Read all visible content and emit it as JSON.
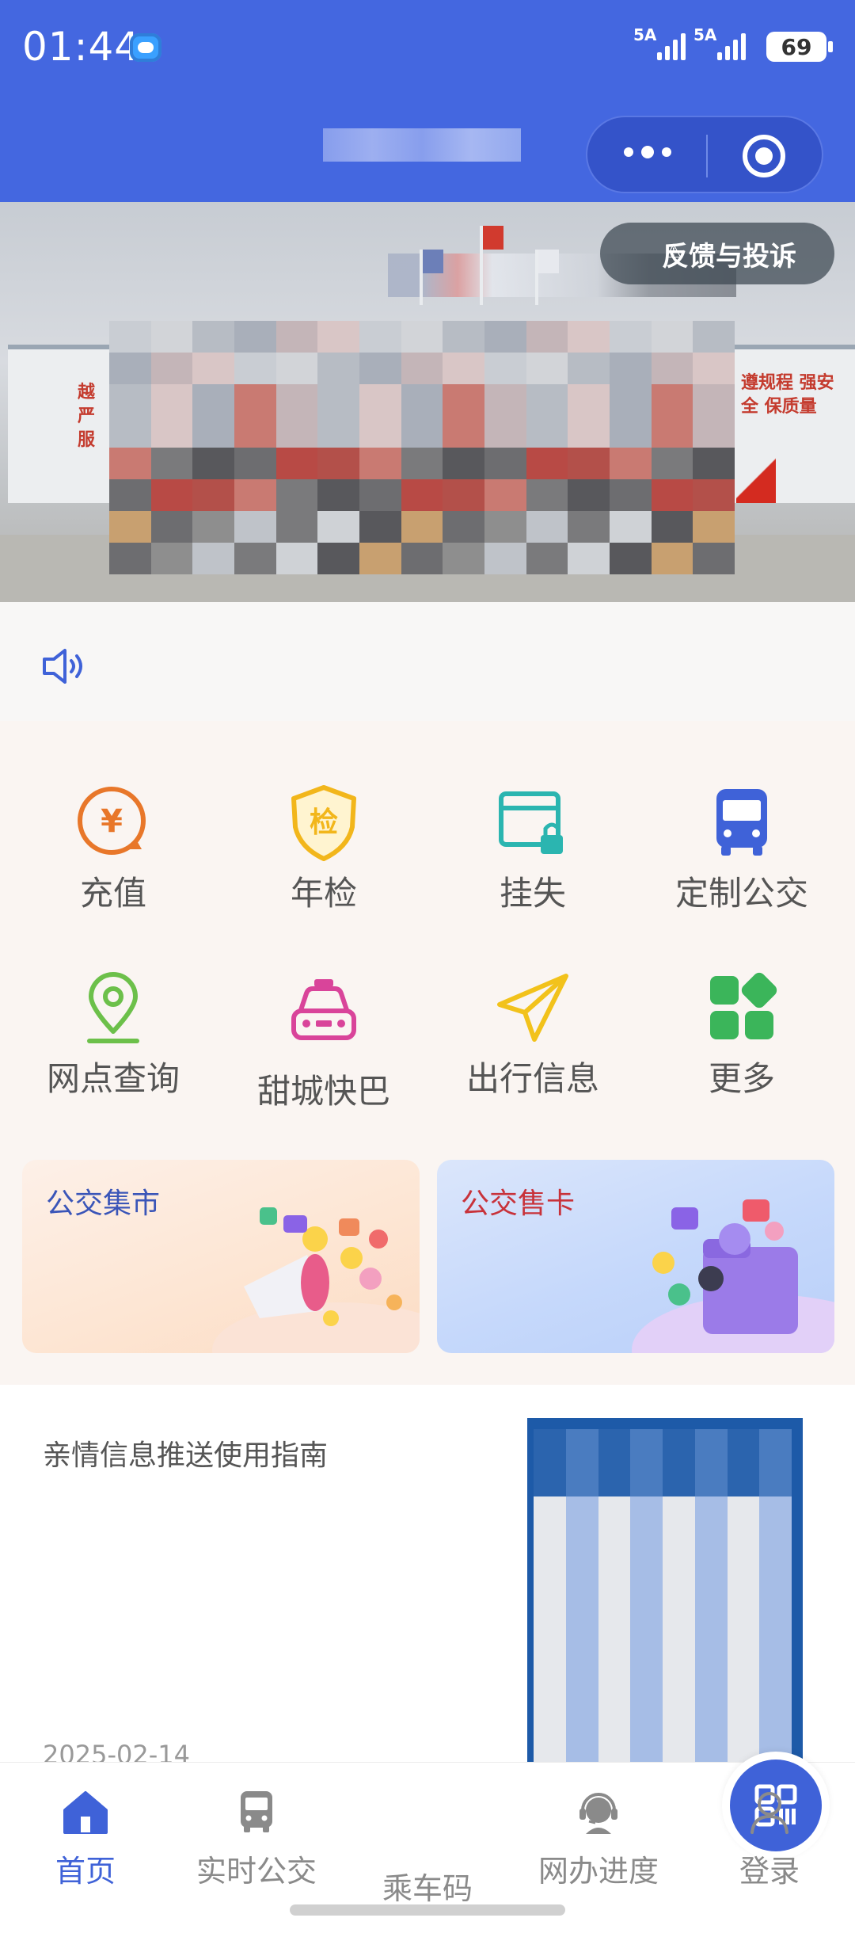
{
  "status_bar": {
    "time": "01:44",
    "signal1": "5A",
    "signal2": "5A",
    "battery": "69"
  },
  "header": {
    "menu_icon": "more-dots-icon",
    "target_icon": "target-icon"
  },
  "banner": {
    "feedback_label": "反馈与投诉",
    "left_wall_text": "越 严 服",
    "right_wall_text": "遵规程 强安全 保质量"
  },
  "menu": [
    {
      "label": "充值",
      "icon": "yen-recharge-icon",
      "color": "#e8772a"
    },
    {
      "label": "年检",
      "icon": "shield-check-icon",
      "color": "#f2b61b"
    },
    {
      "label": "挂失",
      "icon": "card-lock-icon",
      "color": "#2bb5b0"
    },
    {
      "label": "定制公交",
      "icon": "bus-icon",
      "color": "#3f62d8"
    },
    {
      "label": "网点查询",
      "icon": "location-pin-icon",
      "color": "#6cc04a"
    },
    {
      "label": "甜城快巴",
      "icon": "taxi-icon",
      "color": "#d9449a"
    },
    {
      "label": "出行信息",
      "icon": "paper-plane-icon",
      "color": "#f2c21b"
    },
    {
      "label": "更多",
      "icon": "apps-grid-icon",
      "color": "#3bb55a"
    }
  ],
  "cards": [
    {
      "title": "公交集市"
    },
    {
      "title": "公交售卡"
    }
  ],
  "article": {
    "title": "亲情信息推送使用指南",
    "date": "2025-02-14"
  },
  "tabbar": [
    {
      "label": "首页",
      "icon": "home-icon",
      "active": true
    },
    {
      "label": "实时公交",
      "icon": "bus-icon"
    },
    {
      "label": "乘车码",
      "icon": "qr-code-icon"
    },
    {
      "label": "网办进度",
      "icon": "support-agent-icon"
    },
    {
      "label": "登录",
      "icon": "user-icon"
    }
  ],
  "colors": {
    "brand": "#4467e0",
    "active_tab": "#3f62d8"
  }
}
